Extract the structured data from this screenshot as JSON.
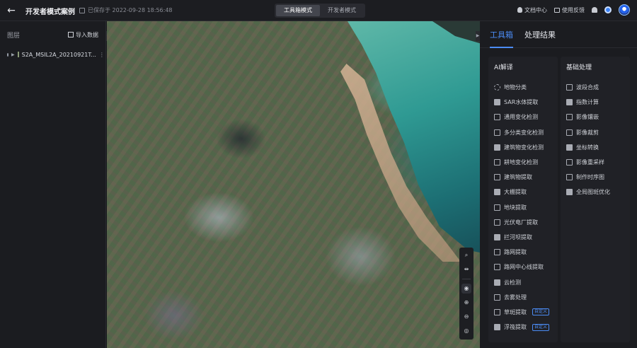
{
  "header": {
    "back_icon": "arrow-left-icon",
    "title": "开发者模式案例",
    "save_status": "已保存于 2022-09-28 18:56:48",
    "modes": [
      {
        "label": "工具箱模式",
        "active": true
      },
      {
        "label": "开发者模式",
        "active": false
      }
    ],
    "docs_label": "文档中心",
    "feedback_label": "使用反馈"
  },
  "left_panel": {
    "title": "图层",
    "import_label": "导入数据",
    "layers": [
      {
        "name": "S2A_MSIL2A_20210921T...",
        "visible": true
      }
    ]
  },
  "map": {
    "tools": [
      "search-icon",
      "swap-icon",
      "globe-icon",
      "zoom-in-icon",
      "zoom-out-icon",
      "locate-icon"
    ]
  },
  "right_panel": {
    "tabs": [
      {
        "label": "工具箱",
        "active": true
      },
      {
        "label": "处理结果",
        "active": false
      }
    ],
    "ai_column": {
      "title": "AI解译",
      "items": [
        {
          "label": "地物分类",
          "icon": "classify-icon"
        },
        {
          "label": "SAR水体提取",
          "icon": "water-icon"
        },
        {
          "label": "通用变化检测",
          "icon": "change-icon"
        },
        {
          "label": "多分类变化检测",
          "icon": "multi-change-icon"
        },
        {
          "label": "建筑物变化检测",
          "icon": "building-change-icon"
        },
        {
          "label": "耕地变化检测",
          "icon": "farmland-change-icon"
        },
        {
          "label": "建筑物提取",
          "icon": "building-icon"
        },
        {
          "label": "大棚提取",
          "icon": "greenhouse-icon"
        },
        {
          "label": "地块提取",
          "icon": "parcel-icon"
        },
        {
          "label": "光伏电厂提取",
          "icon": "solar-icon"
        },
        {
          "label": "拦河坝提取",
          "icon": "dam-icon"
        },
        {
          "label": "路网提取",
          "icon": "road-icon"
        },
        {
          "label": "路网中心线提取",
          "icon": "road-centerline-icon"
        },
        {
          "label": "云检测",
          "icon": "cloud-icon"
        },
        {
          "label": "去雾处理",
          "icon": "dehaze-icon"
        },
        {
          "label": "草斑提取",
          "icon": "grass-icon",
          "badge": "自定义"
        },
        {
          "label": "浮筏提取",
          "icon": "raft-icon",
          "badge": "自定义"
        }
      ]
    },
    "basic_column": {
      "title": "基础处理",
      "items": [
        {
          "label": "波段合成",
          "icon": "layers-icon"
        },
        {
          "label": "指数计算",
          "icon": "index-icon"
        },
        {
          "label": "影像镶嵌",
          "icon": "mosaic-icon"
        },
        {
          "label": "影像裁剪",
          "icon": "crop-icon"
        },
        {
          "label": "坐标转换",
          "icon": "coordinate-icon"
        },
        {
          "label": "影像重采样",
          "icon": "resample-icon"
        },
        {
          "label": "制作时序图",
          "icon": "timeseries-icon"
        },
        {
          "label": "全局图斑优化",
          "icon": "optimize-icon"
        }
      ]
    }
  }
}
